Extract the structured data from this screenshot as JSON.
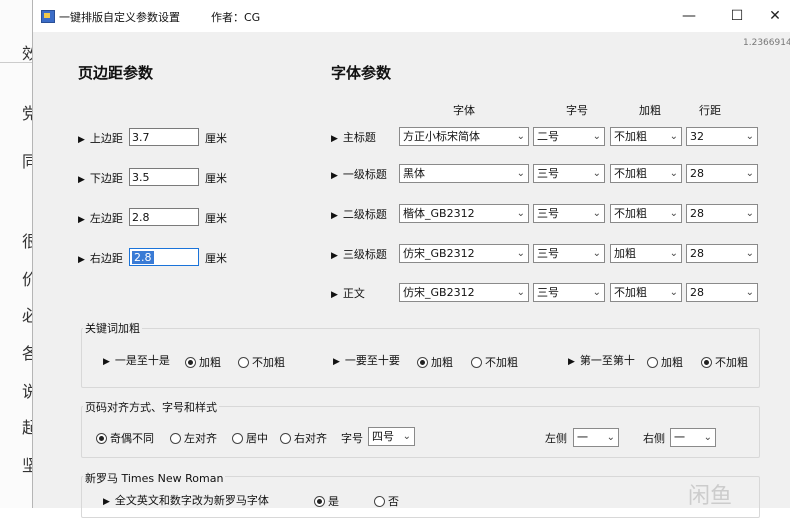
{
  "window": {
    "title": "一键排版自定义参数设置",
    "author": "作者：CG",
    "version": "1.2366914",
    "controls": {
      "minimize": "—",
      "maximize": "☐",
      "close": "✕"
    }
  },
  "background_doc_chars": [
    "效",
    "党",
    "同",
    "很",
    "价",
    "必",
    "各",
    "说",
    "起",
    "坚"
  ],
  "margins": {
    "heading": "页边距参数",
    "unit": "厘米",
    "rows": [
      {
        "label": "上边距",
        "value": "3.7"
      },
      {
        "label": "下边距",
        "value": "3.5"
      },
      {
        "label": "左边距",
        "value": "2.8"
      },
      {
        "label": "右边距",
        "value": "2.8"
      }
    ]
  },
  "fonts": {
    "heading": "字体参数",
    "columns": [
      "字体",
      "字号",
      "加粗",
      "行距"
    ],
    "rows": [
      {
        "label": "主标题",
        "font": "方正小标宋简体",
        "size": "二号",
        "bold": "不加粗",
        "spacing": "32"
      },
      {
        "label": "一级标题",
        "font": "黑体",
        "size": "三号",
        "bold": "不加粗",
        "spacing": "28"
      },
      {
        "label": "二级标题",
        "font": "楷体_GB2312",
        "size": "三号",
        "bold": "不加粗",
        "spacing": "28"
      },
      {
        "label": "三级标题",
        "font": "仿宋_GB2312",
        "size": "三号",
        "bold": "加粗",
        "spacing": "28"
      },
      {
        "label": "正文",
        "font": "仿宋_GB2312",
        "size": "三号",
        "bold": "不加粗",
        "spacing": "28"
      }
    ]
  },
  "keyword_bold": {
    "title": "关键词加粗",
    "groups": [
      {
        "label": "一是至十是",
        "options": [
          "加粗",
          "不加粗"
        ],
        "selected": 0
      },
      {
        "label": "一要至十要",
        "options": [
          "加粗",
          "不加粗"
        ],
        "selected": 0
      },
      {
        "label": "第一至第十",
        "options": [
          "加粗",
          "不加粗"
        ],
        "selected": 1
      }
    ]
  },
  "page_number": {
    "title": "页码对齐方式、字号和样式",
    "align_options": [
      "奇偶不同",
      "左对齐",
      "居中",
      "右对齐"
    ],
    "selected": 0,
    "size_label": "字号",
    "size_value": "四号",
    "left_label": "左侧",
    "left_value": "一",
    "right_label": "右侧",
    "right_value": "一"
  },
  "times_font": {
    "title": "新罗马  Times New Roman",
    "row_label": "全文英文和数字改为新罗马字体",
    "options": [
      "是",
      "否"
    ],
    "selected": 0
  },
  "icons": {
    "arrow": "▶",
    "dropdown": "⌄"
  },
  "watermark": "闲鱼"
}
